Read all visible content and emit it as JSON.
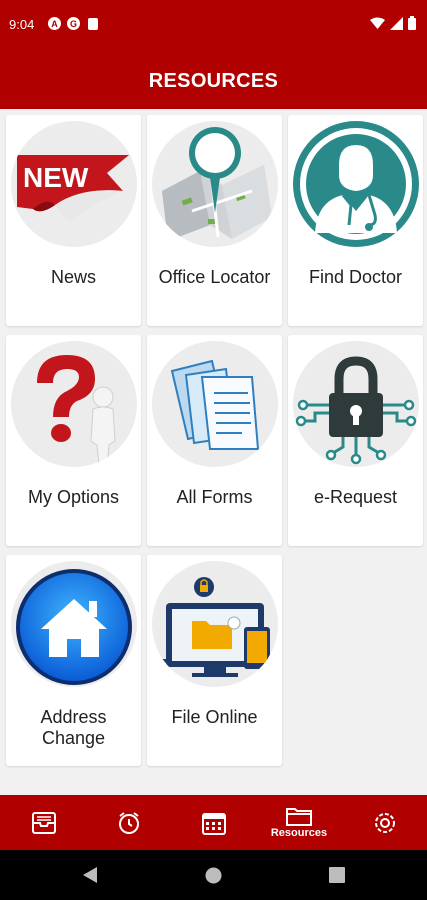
{
  "status": {
    "time": "9:04",
    "left_icons": [
      "a-icon",
      "g-icon",
      "clipboard-icon"
    ],
    "right_icons": [
      "wifi-icon",
      "signal-icon",
      "battery-icon"
    ]
  },
  "header": {
    "title": "RESOURCES"
  },
  "tiles": [
    {
      "label": "News",
      "icon": "news-icon"
    },
    {
      "label": "Office Locator",
      "icon": "map-pin-icon"
    },
    {
      "label": "Find Doctor",
      "icon": "doctor-icon"
    },
    {
      "label": "My Options",
      "icon": "question-mark-icon"
    },
    {
      "label": "All Forms",
      "icon": "documents-icon"
    },
    {
      "label": "e-Request",
      "icon": "padlock-circuit-icon"
    },
    {
      "label": "Address Change",
      "label_line1": "Address",
      "label_line2": "Change",
      "icon": "home-icon"
    },
    {
      "label": "File Online",
      "icon": "computer-files-icon"
    }
  ],
  "news_badge": "NEW",
  "bottom_nav": {
    "items": [
      {
        "icon": "inbox-icon",
        "label": ""
      },
      {
        "icon": "alarm-clock-icon",
        "label": ""
      },
      {
        "icon": "calendar-icon",
        "label": ""
      },
      {
        "icon": "folder-icon",
        "label": "Resources",
        "active": true
      },
      {
        "icon": "settings-icon",
        "label": ""
      }
    ]
  },
  "colors": {
    "brand": "#b00000",
    "teal": "#2a8a8a",
    "background": "#f1f1f1"
  }
}
